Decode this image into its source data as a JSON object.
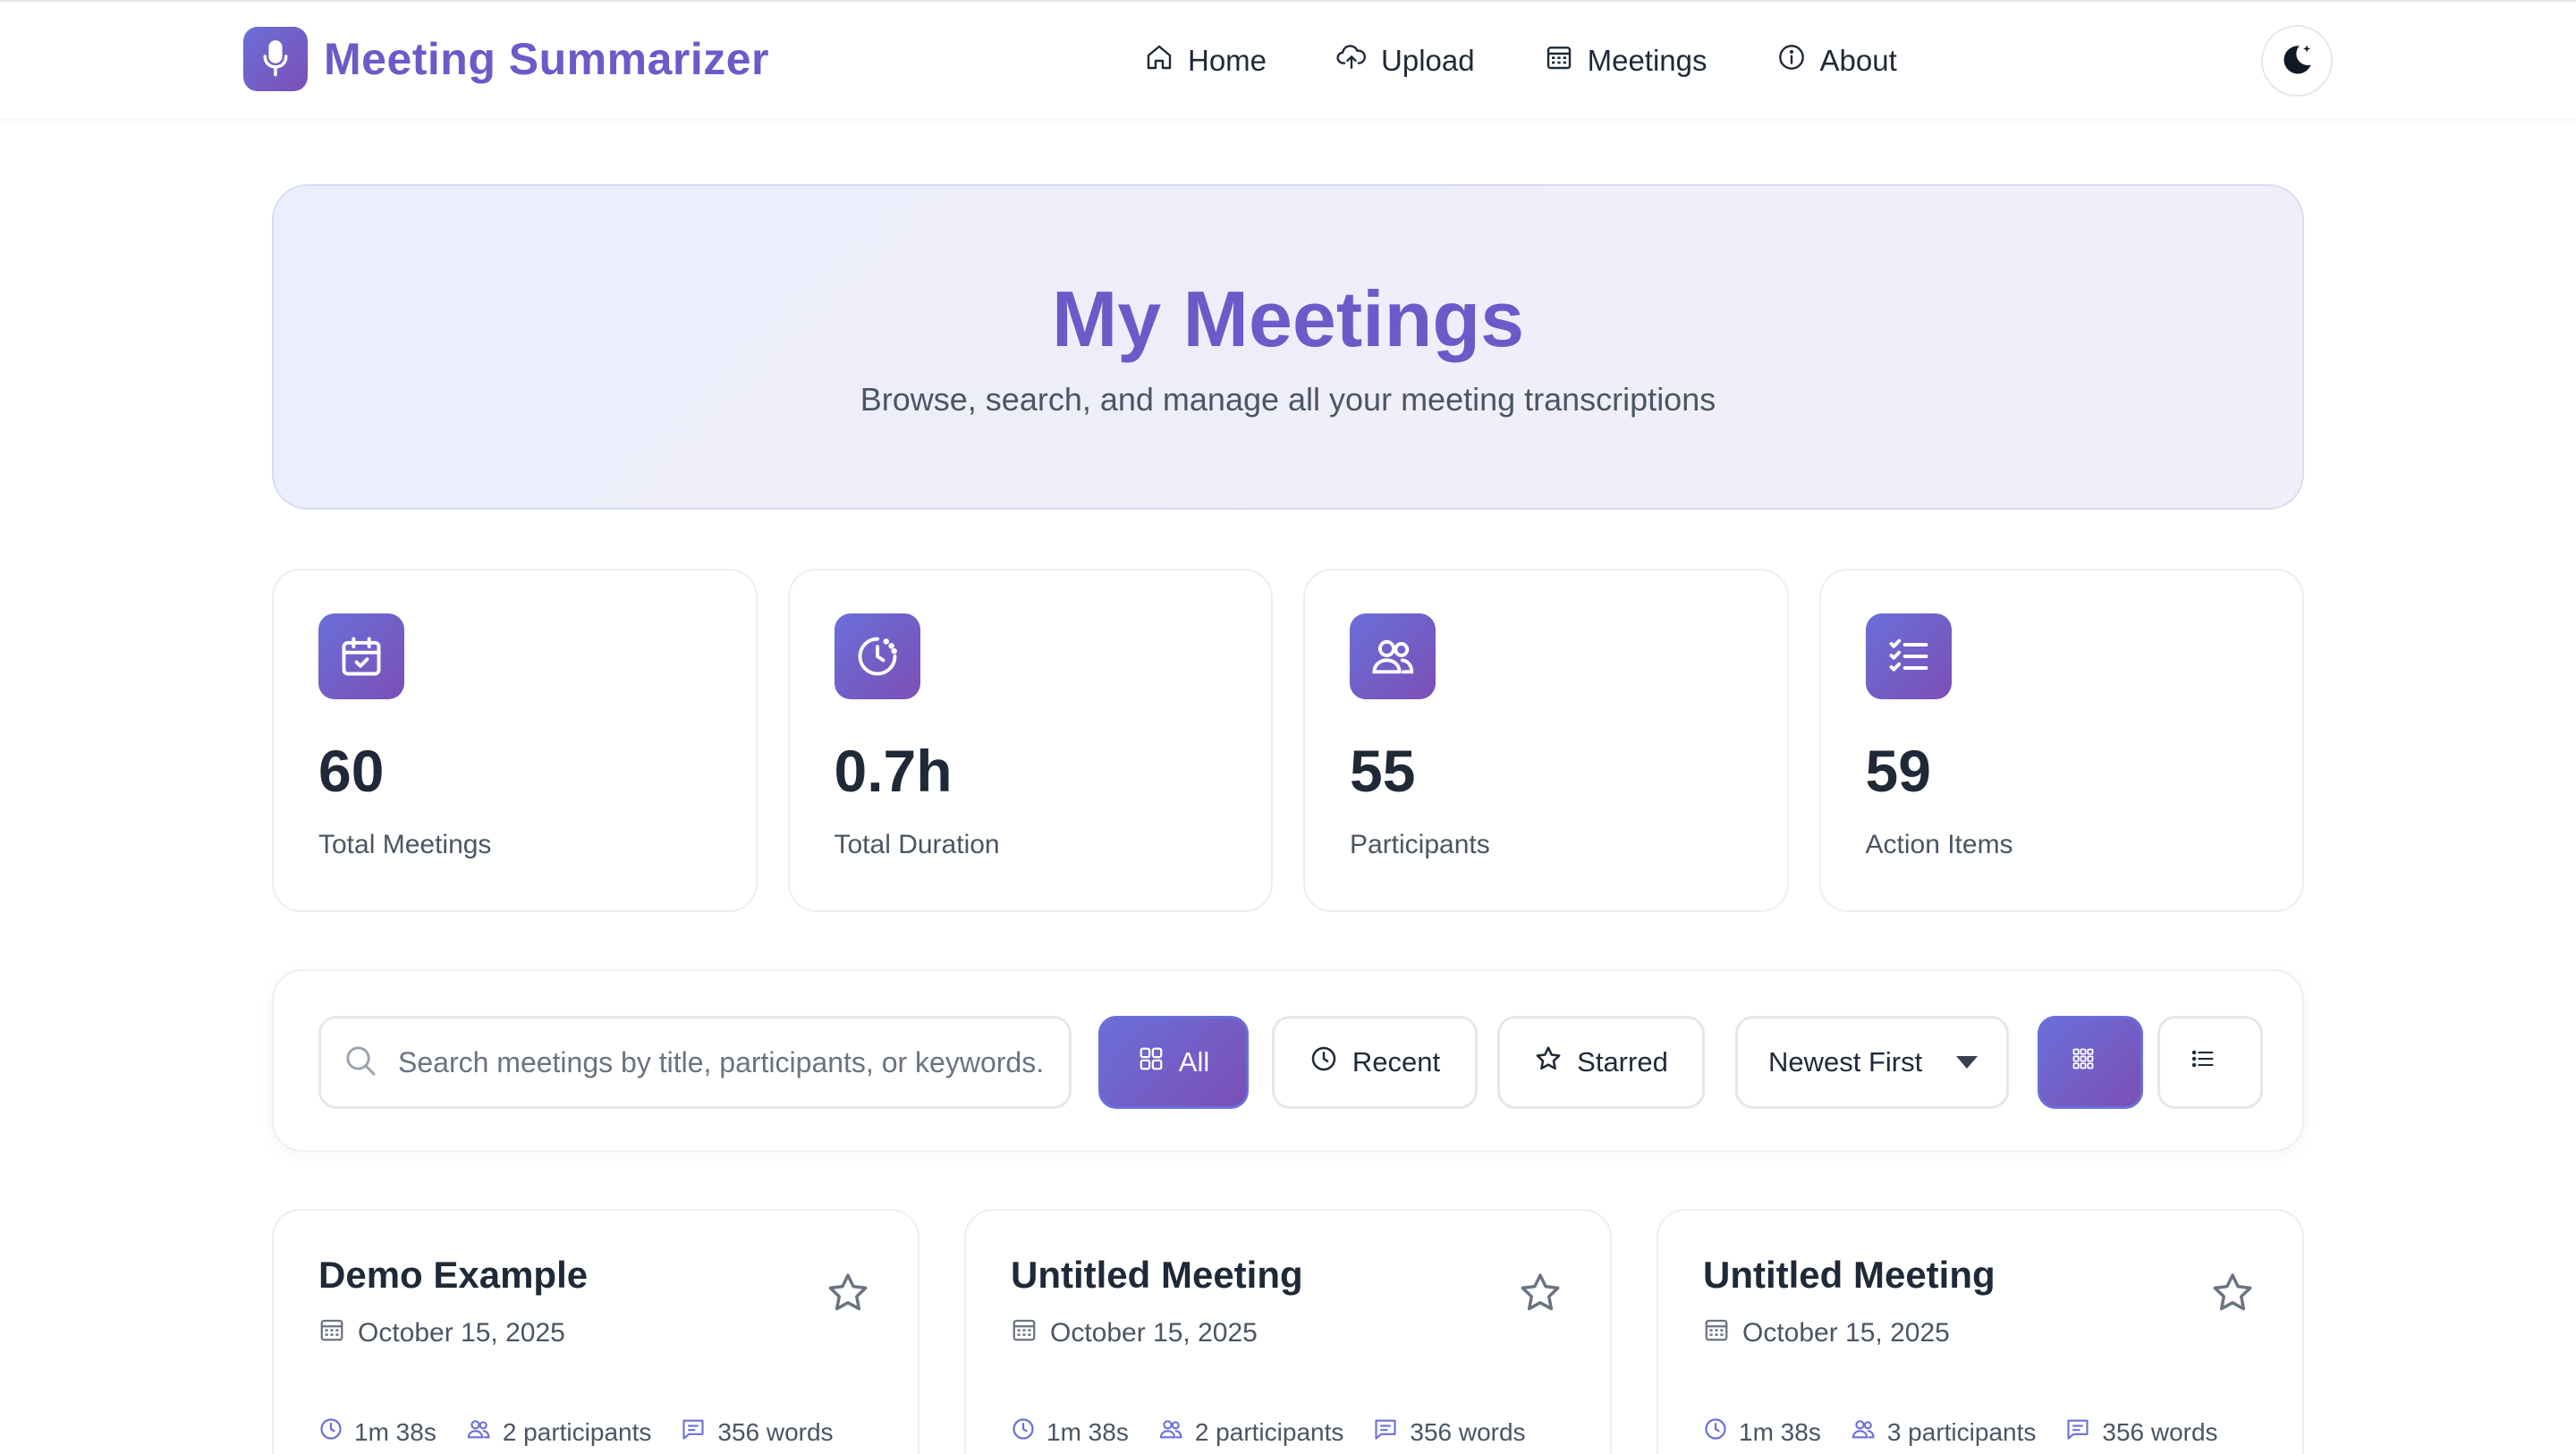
{
  "brand": {
    "name": "Meeting Summarizer",
    "icon": "microphone-icon"
  },
  "nav": {
    "items": [
      {
        "label": "Home",
        "icon": "home-icon"
      },
      {
        "label": "Upload",
        "icon": "cloud-upload-icon"
      },
      {
        "label": "Meetings",
        "icon": "calendar-icon"
      },
      {
        "label": "About",
        "icon": "info-icon"
      }
    ],
    "theme_toggle_icon": "moon-stars-icon"
  },
  "hero": {
    "title": "My Meetings",
    "subtitle": "Browse, search, and manage all your meeting transcriptions"
  },
  "stats": [
    {
      "value": "60",
      "label": "Total Meetings",
      "icon": "calendar-check-icon"
    },
    {
      "value": "0.7h",
      "label": "Total Duration",
      "icon": "clock-icon"
    },
    {
      "value": "55",
      "label": "Participants",
      "icon": "users-icon"
    },
    {
      "value": "59",
      "label": "Action Items",
      "icon": "checklist-icon"
    }
  ],
  "toolbar": {
    "search_placeholder": "Search meetings by title, participants, or keywords...",
    "filters": [
      {
        "label": "All",
        "active": true
      },
      {
        "label": "Recent",
        "active": false
      },
      {
        "label": "Starred",
        "active": false
      }
    ],
    "sort_selected": "Newest First",
    "view_mode": "grid"
  },
  "meetings": [
    {
      "title": "Demo Example",
      "date": "October 15, 2025",
      "duration": "1m 38s",
      "participants": "2 participants",
      "words": "356 words",
      "starred": false
    },
    {
      "title": "Untitled Meeting",
      "date": "October 15, 2025",
      "duration": "1m 38s",
      "participants": "2 participants",
      "words": "356 words",
      "starred": false
    },
    {
      "title": "Untitled Meeting",
      "date": "October 15, 2025",
      "duration": "1m 38s",
      "participants": "3 participants",
      "words": "356 words",
      "starred": false
    }
  ],
  "colors": {
    "accent_start": "#6a6fd8",
    "accent_end": "#7b4fb6",
    "brand_text": "#6b5bc9"
  }
}
